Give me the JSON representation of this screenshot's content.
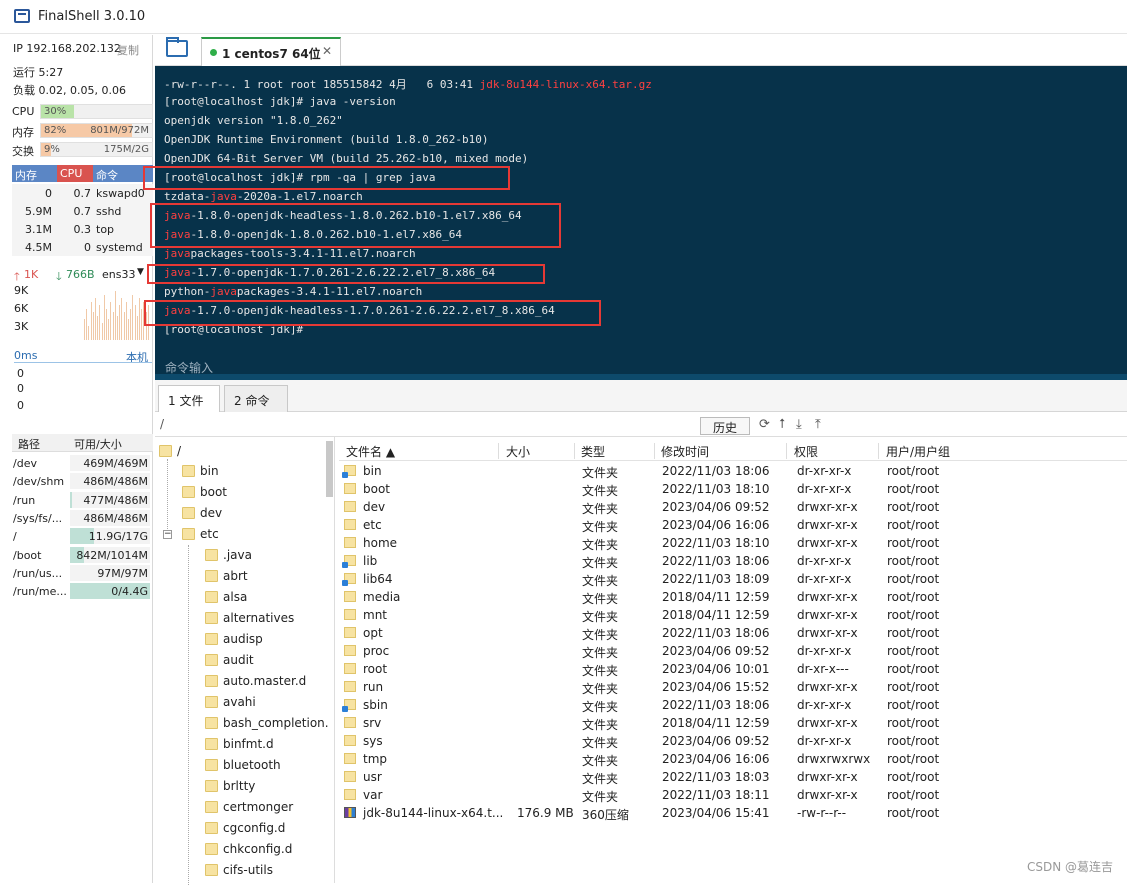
{
  "window": {
    "title": "FinalShell 3.0.10"
  },
  "monitor": {
    "ip_label": "IP 192.168.202.132",
    "copy_label": "复制",
    "uptime": "运行 5:27",
    "load": "负载 0.02, 0.05, 0.06",
    "cpu": {
      "label": "CPU",
      "pct_text": "30%",
      "pct": 30,
      "value": ""
    },
    "mem": {
      "label": "内存",
      "pct_text": "82%",
      "pct": 82,
      "value": "801M/972M"
    },
    "swap": {
      "label": "交换",
      "pct_text": "9%",
      "pct": 9,
      "value": "175M/2G"
    },
    "proc_headers": [
      "内存",
      "CPU",
      "命令"
    ],
    "processes": [
      {
        "mem": "0",
        "cpu": "0.7",
        "cmd": "kswapd0"
      },
      {
        "mem": "5.9M",
        "cpu": "0.7",
        "cmd": "sshd"
      },
      {
        "mem": "3.1M",
        "cpu": "0.3",
        "cmd": "top"
      },
      {
        "mem": "4.5M",
        "cpu": "0",
        "cmd": "systemd"
      }
    ],
    "net": {
      "up": "1K",
      "down": "766B",
      "iface": "ens33",
      "ticks": [
        "9K",
        "6K",
        "3K"
      ]
    },
    "latency": {
      "ms": "0ms",
      "host": "本机",
      "ticks": [
        "0",
        "0",
        "0"
      ]
    },
    "disk_headers": [
      "路径",
      "可用/大小"
    ],
    "disks": [
      {
        "path": "/dev",
        "value": "469M/469M",
        "used": 0
      },
      {
        "path": "/dev/shm",
        "value": "486M/486M",
        "used": 0
      },
      {
        "path": "/run",
        "value": "477M/486M",
        "used": 0.02
      },
      {
        "path": "/sys/fs/...",
        "value": "486M/486M",
        "used": 0
      },
      {
        "path": "/",
        "value": "11.9G/17G",
        "used": 0.3
      },
      {
        "path": "/boot",
        "value": "842M/1014M",
        "used": 0.17
      },
      {
        "path": "/run/us...",
        "value": "97M/97M",
        "used": 0
      },
      {
        "path": "/run/me...",
        "value": "0/4.4G",
        "used": 1.0
      }
    ]
  },
  "session_tab": {
    "label": "1 centos7 64位",
    "close": "✕"
  },
  "terminal": {
    "lines": [
      [
        {
          "t": "-rw-r--r--. 1 root root 185515842 4月   6 03:41 "
        },
        {
          "t": "jdk-8u144-linux-x64.tar.gz",
          "c": "red"
        }
      ],
      [
        {
          "t": "[root@localhost jdk]# java -version"
        }
      ],
      [
        {
          "t": "openjdk version \"1.8.0_262\""
        }
      ],
      [
        {
          "t": "OpenJDK Runtime Environment (build 1.8.0_262-b10)"
        }
      ],
      [
        {
          "t": "OpenJDK 64-Bit Server VM (build 25.262-b10, mixed mode)"
        }
      ],
      [
        {
          "t": "[root@localhost jdk]# rpm -qa | grep java"
        }
      ],
      [
        {
          "t": "tzdata-"
        },
        {
          "t": "java",
          "c": "red"
        },
        {
          "t": "-2020a-1.el7.noarch"
        }
      ],
      [
        {
          "t": "java",
          "c": "red"
        },
        {
          "t": "-1.8.0-openjdk-headless-1.8.0.262.b10-1.el7.x86_64"
        }
      ],
      [
        {
          "t": "java",
          "c": "red"
        },
        {
          "t": "-1.8.0-openjdk-1.8.0.262.b10-1.el7.x86_64"
        }
      ],
      [
        {
          "t": "java",
          "c": "red"
        },
        {
          "t": "packages-tools-3.4.1-11.el7.noarch"
        }
      ],
      [
        {
          "t": "java",
          "c": "red"
        },
        {
          "t": "-1.7.0-openjdk-1.7.0.261-2.6.22.2.el7_8.x86_64"
        }
      ],
      [
        {
          "t": "python-"
        },
        {
          "t": "java",
          "c": "red"
        },
        {
          "t": "packages-3.4.1-11.el7.noarch"
        }
      ],
      [
        {
          "t": "java",
          "c": "red"
        },
        {
          "t": "-1.7.0-openjdk-headless-1.7.0.261-2.6.22.2.el7_8.x86_64"
        }
      ],
      [
        {
          "t": "[root@localhost jdk]#"
        }
      ]
    ],
    "command_input_label": "命令输入"
  },
  "file_tabs": [
    "1 文件",
    "2 命令"
  ],
  "path": {
    "current": "/",
    "history_label": "历史"
  },
  "tree": {
    "root": "/",
    "top_items": [
      "bin",
      "boot",
      "dev",
      "etc"
    ],
    "etc_children": [
      ".java",
      "abrt",
      "alsa",
      "alternatives",
      "audisp",
      "audit",
      "auto.master.d",
      "avahi",
      "bash_completion.",
      "binfmt.d",
      "bluetooth",
      "brltty",
      "certmonger",
      "cgconfig.d",
      "chkconfig.d",
      "cifs-utils"
    ]
  },
  "file_table": {
    "headers": [
      "文件名 ▲",
      "大小",
      "类型",
      "修改时间",
      "权限",
      "用户/用户组"
    ],
    "rows": [
      {
        "icon": "link",
        "name": "bin",
        "size": "",
        "type": "文件夹",
        "mtime": "2022/11/03 18:06",
        "perm": "dr-xr-xr-x",
        "owner": "root/root"
      },
      {
        "icon": "folder",
        "name": "boot",
        "size": "",
        "type": "文件夹",
        "mtime": "2022/11/03 18:10",
        "perm": "dr-xr-xr-x",
        "owner": "root/root"
      },
      {
        "icon": "folder",
        "name": "dev",
        "size": "",
        "type": "文件夹",
        "mtime": "2023/04/06 09:52",
        "perm": "drwxr-xr-x",
        "owner": "root/root"
      },
      {
        "icon": "folder",
        "name": "etc",
        "size": "",
        "type": "文件夹",
        "mtime": "2023/04/06 16:06",
        "perm": "drwxr-xr-x",
        "owner": "root/root"
      },
      {
        "icon": "folder",
        "name": "home",
        "size": "",
        "type": "文件夹",
        "mtime": "2022/11/03 18:10",
        "perm": "drwxr-xr-x",
        "owner": "root/root"
      },
      {
        "icon": "link",
        "name": "lib",
        "size": "",
        "type": "文件夹",
        "mtime": "2022/11/03 18:06",
        "perm": "dr-xr-xr-x",
        "owner": "root/root"
      },
      {
        "icon": "link",
        "name": "lib64",
        "size": "",
        "type": "文件夹",
        "mtime": "2022/11/03 18:09",
        "perm": "dr-xr-xr-x",
        "owner": "root/root"
      },
      {
        "icon": "folder",
        "name": "media",
        "size": "",
        "type": "文件夹",
        "mtime": "2018/04/11 12:59",
        "perm": "drwxr-xr-x",
        "owner": "root/root"
      },
      {
        "icon": "folder",
        "name": "mnt",
        "size": "",
        "type": "文件夹",
        "mtime": "2018/04/11 12:59",
        "perm": "drwxr-xr-x",
        "owner": "root/root"
      },
      {
        "icon": "folder",
        "name": "opt",
        "size": "",
        "type": "文件夹",
        "mtime": "2022/11/03 18:06",
        "perm": "drwxr-xr-x",
        "owner": "root/root"
      },
      {
        "icon": "folder",
        "name": "proc",
        "size": "",
        "type": "文件夹",
        "mtime": "2023/04/06 09:52",
        "perm": "dr-xr-xr-x",
        "owner": "root/root"
      },
      {
        "icon": "folder",
        "name": "root",
        "size": "",
        "type": "文件夹",
        "mtime": "2023/04/06 10:01",
        "perm": "dr-xr-x---",
        "owner": "root/root"
      },
      {
        "icon": "folder",
        "name": "run",
        "size": "",
        "type": "文件夹",
        "mtime": "2023/04/06 15:52",
        "perm": "drwxr-xr-x",
        "owner": "root/root"
      },
      {
        "icon": "link",
        "name": "sbin",
        "size": "",
        "type": "文件夹",
        "mtime": "2022/11/03 18:06",
        "perm": "dr-xr-xr-x",
        "owner": "root/root"
      },
      {
        "icon": "folder",
        "name": "srv",
        "size": "",
        "type": "文件夹",
        "mtime": "2018/04/11 12:59",
        "perm": "drwxr-xr-x",
        "owner": "root/root"
      },
      {
        "icon": "folder",
        "name": "sys",
        "size": "",
        "type": "文件夹",
        "mtime": "2023/04/06 09:52",
        "perm": "dr-xr-xr-x",
        "owner": "root/root"
      },
      {
        "icon": "folder",
        "name": "tmp",
        "size": "",
        "type": "文件夹",
        "mtime": "2023/04/06 16:06",
        "perm": "drwxrwxrwx",
        "owner": "root/root"
      },
      {
        "icon": "folder",
        "name": "usr",
        "size": "",
        "type": "文件夹",
        "mtime": "2022/11/03 18:03",
        "perm": "drwxr-xr-x",
        "owner": "root/root"
      },
      {
        "icon": "folder",
        "name": "var",
        "size": "",
        "type": "文件夹",
        "mtime": "2022/11/03 18:11",
        "perm": "drwxr-xr-x",
        "owner": "root/root"
      },
      {
        "icon": "archive",
        "name": "jdk-8u144-linux-x64.t...",
        "size": "176.9 MB",
        "type": "360压缩",
        "mtime": "2023/04/06 15:41",
        "perm": "-rw-r--r--",
        "owner": "root/root"
      }
    ]
  },
  "watermark": "CSDN @葛连吉",
  "colors": {
    "terminal_bg": "#07324a",
    "highlight_red": "#e53935",
    "java_red": "#ff4040",
    "session_green": "#2fae49"
  }
}
